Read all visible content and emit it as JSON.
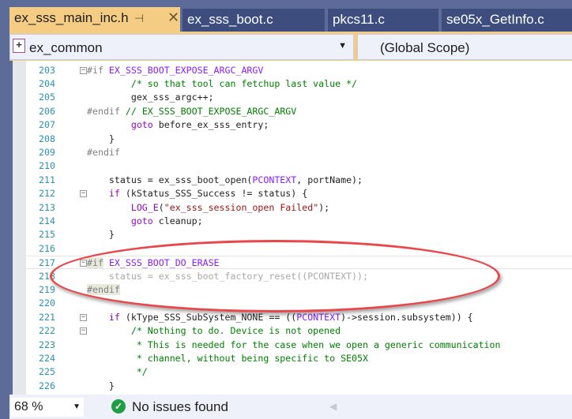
{
  "tabs": [
    {
      "label": "ex_sss_main_inc.h",
      "active": true,
      "pin_icon": "pin-icon",
      "close_icon": "close-icon"
    },
    {
      "label": "ex_sss_boot.c"
    },
    {
      "label": "pkcs11.c"
    },
    {
      "label": "se05x_GetInfo.c"
    }
  ],
  "navbar": {
    "project": "ex_common",
    "scope": "(Global Scope)"
  },
  "lines": [
    {
      "n": "203",
      "fold": "−",
      "tokens": [
        [
          "#if ",
          "pp"
        ],
        [
          "EX_SSS_BOOT_EXPOSE_ARGC_ARGV",
          "mac"
        ]
      ]
    },
    {
      "n": "204",
      "tokens": [
        [
          "        /* so that tool can fetchup last value */",
          "cm"
        ]
      ]
    },
    {
      "n": "205",
      "tokens": [
        [
          "        gex_sss_argc++;",
          "pl"
        ]
      ]
    },
    {
      "n": "206",
      "tokens": [
        [
          "#endif ",
          "pp"
        ],
        [
          "// EX_SSS_BOOT_EXPOSE_ARGC_ARGV",
          "cm"
        ]
      ]
    },
    {
      "n": "207",
      "tokens": [
        [
          "        ",
          "pl"
        ],
        [
          "goto",
          "kw"
        ],
        [
          " before_ex_sss_entry;",
          "pl"
        ]
      ]
    },
    {
      "n": "208",
      "tokens": [
        [
          "    }",
          "pl"
        ]
      ]
    },
    {
      "n": "209",
      "tokens": [
        [
          "#endif",
          "pp"
        ]
      ]
    },
    {
      "n": "210",
      "tokens": []
    },
    {
      "n": "211",
      "tokens": [
        [
          "    status = ex_sss_boot_open(",
          "pl"
        ],
        [
          "PCONTEXT",
          "mac"
        ],
        [
          ", portName);",
          "pl"
        ]
      ]
    },
    {
      "n": "212",
      "fold": "−",
      "tokens": [
        [
          "    ",
          "pl"
        ],
        [
          "if",
          "kw"
        ],
        [
          " (kStatus_SSS_Success != status) {",
          "pl"
        ]
      ]
    },
    {
      "n": "213",
      "tokens": [
        [
          "        ",
          "pl"
        ],
        [
          "LOG_E",
          "kw"
        ],
        [
          "(",
          "pl"
        ],
        [
          "\"ex_sss_session_open Failed\"",
          "str"
        ],
        [
          ");",
          "pl"
        ]
      ]
    },
    {
      "n": "214",
      "tokens": [
        [
          "        ",
          "pl"
        ],
        [
          "goto",
          "kw"
        ],
        [
          " cleanup;",
          "pl"
        ]
      ]
    },
    {
      "n": "215",
      "tokens": [
        [
          "    }",
          "pl"
        ]
      ]
    },
    {
      "n": "216",
      "tokens": []
    },
    {
      "n": "217",
      "fold": "−",
      "cur": true,
      "tokens": [
        [
          "#if",
          "ppbg"
        ],
        [
          " ",
          "pl"
        ],
        [
          "EX_SSS_BOOT_DO_ERASE",
          "mac"
        ]
      ]
    },
    {
      "n": "218",
      "tokens": [
        [
          "    status = ex_sss_boot_factory_reset((PCONTEXT));",
          "dim"
        ]
      ]
    },
    {
      "n": "219",
      "tokens": [
        [
          "#endif",
          "ppbg"
        ]
      ]
    },
    {
      "n": "220",
      "tokens": []
    },
    {
      "n": "221",
      "fold": "−",
      "tokens": [
        [
          "    ",
          "pl"
        ],
        [
          "if",
          "kw"
        ],
        [
          " (kType_SSS_SubSystem_NONE == ((",
          "pl"
        ],
        [
          "PCONTEXT",
          "mac"
        ],
        [
          ")->session.subsystem)) {",
          "pl"
        ]
      ]
    },
    {
      "n": "222",
      "fold": "−",
      "tokens": [
        [
          "        /* Nothing to do. Device is not opened",
          "cm"
        ]
      ]
    },
    {
      "n": "223",
      "tokens": [
        [
          "         * This is needed for the case when we open a generic communication",
          "cm"
        ]
      ]
    },
    {
      "n": "224",
      "tokens": [
        [
          "         * channel, without being specific to SE05X",
          "cm"
        ]
      ]
    },
    {
      "n": "225",
      "tokens": [
        [
          "         */",
          "cm"
        ]
      ]
    },
    {
      "n": "226",
      "tokens": [
        [
          "    }",
          "pl"
        ]
      ]
    }
  ],
  "status": {
    "zoom": "68 %",
    "issues": "No issues found",
    "issues_icon": "check-circle-icon"
  },
  "colors": {
    "tab_active": "#f5cc84",
    "frame": "#5d6b99",
    "annotation": "#e8474c"
  }
}
